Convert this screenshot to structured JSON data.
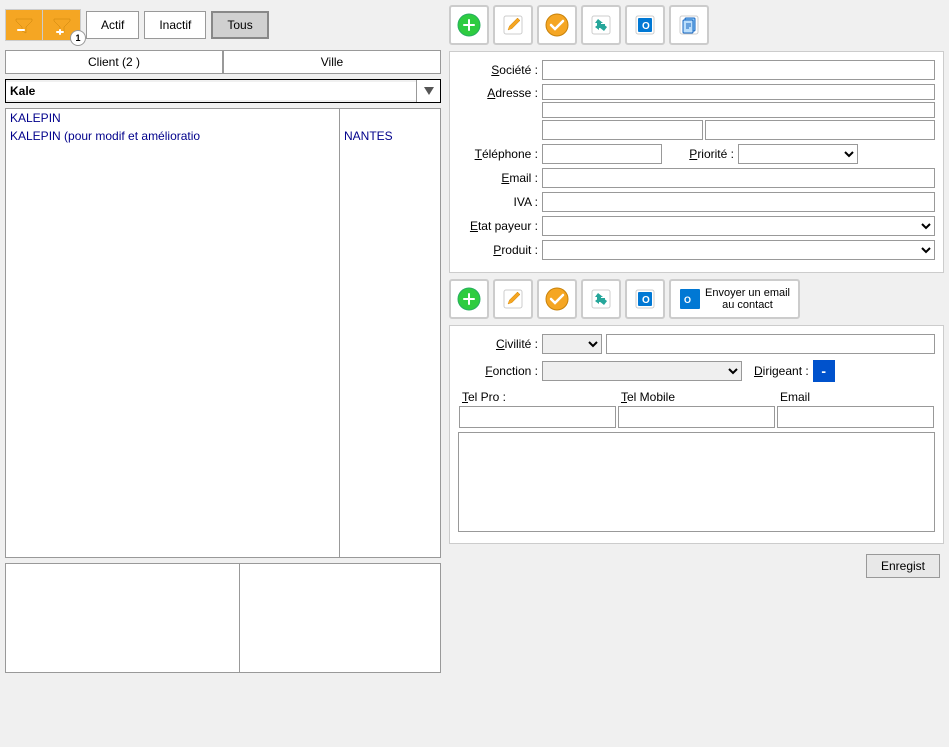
{
  "filters": {
    "actif_label": "Actif",
    "inactif_label": "Inactif",
    "tous_label": "Tous",
    "badge_count": "1"
  },
  "list": {
    "col1_header": "Client (2 )",
    "col2_header": "Ville",
    "search_value": "Kale",
    "results": [
      {
        "name": "KALEPIN",
        "city": ""
      },
      {
        "name": "KALEPIN (pour modif et amélioratio",
        "city": "NANTES"
      }
    ]
  },
  "form": {
    "societe_label": "Société :",
    "adresse_label": "Adresse :",
    "telephone_label": "Téléphone :",
    "priorite_label": "Priorité :",
    "email_label": "Email :",
    "iva_label": "IVA :",
    "etat_payeur_label": "Etat payeur :",
    "produit_label": "Produit :"
  },
  "contact": {
    "civilite_label": "Civilité :",
    "fonction_label": "Fonction :",
    "dirigeant_label": "Dirigeant :",
    "tel_pro_label": "Tel Pro :",
    "tel_mobile_label": "Tel Mobile",
    "email_label": "Email",
    "email_btn_label": "Envoyer un email\nau contact"
  },
  "save_btn_label": "Enregist"
}
